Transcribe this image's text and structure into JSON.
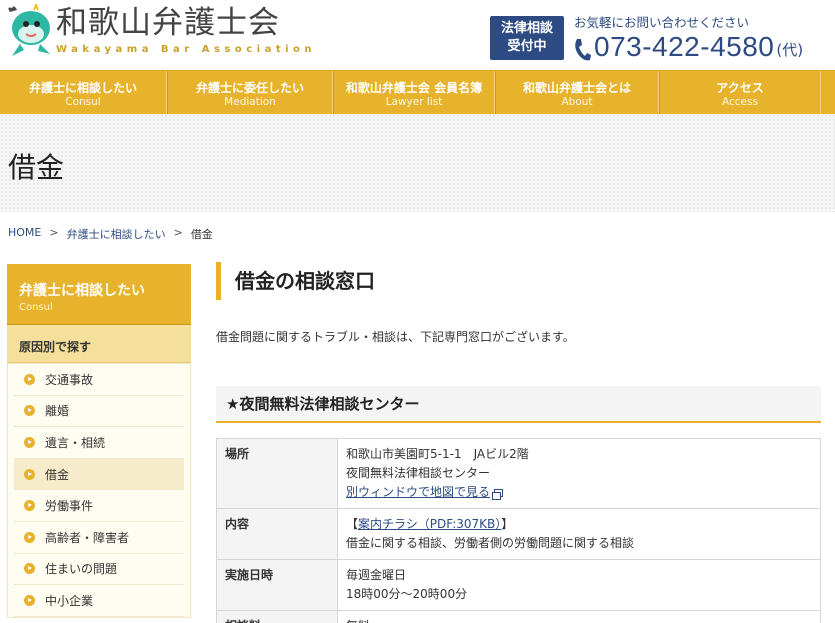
{
  "header": {
    "logo_ja": "和歌山弁護士会",
    "logo_en": "Wakayama Bar Association",
    "badge_line1": "法律相談",
    "badge_line2": "受付中",
    "contact_note": "お気軽にお問い合わせください",
    "phone": "073-422-4580",
    "phone_suffix": "(代)"
  },
  "nav": [
    {
      "ja": "弁護士に相談したい",
      "en": "Consul"
    },
    {
      "ja": "弁護士に委任したい",
      "en": "Mediation"
    },
    {
      "ja": "和歌山弁護士会 会員名簿",
      "en": "Lawyer list"
    },
    {
      "ja": "和歌山弁護士会とは",
      "en": "About"
    },
    {
      "ja": "アクセス",
      "en": "Access"
    }
  ],
  "page_title": "借金",
  "breadcrumb": {
    "home": "HOME",
    "sep": ">",
    "parent": "弁護士に相談したい",
    "current": "借金"
  },
  "sidebar": {
    "head_ja": "弁護士に相談したい",
    "head_en": "Consul",
    "subhead": "原因別で探す",
    "items": [
      "交通事故",
      "離婚",
      "遺言・相続",
      "借金",
      "労働事件",
      "高齢者・障害者",
      "住まいの問題",
      "中小企業"
    ]
  },
  "main": {
    "heading": "借金の相談窓口",
    "intro": "借金問題に関するトラブル・相談は、下記専門窓口がございます。",
    "section_heading": "★夜間無料法律相談センター",
    "table": {
      "place_label": "場所",
      "place_line1": "和歌山市美園町5-1-1　JAビル2階",
      "place_line2": "夜間無料法律相談センター",
      "place_link": "別ウィンドウで地図で見る",
      "content_label": "内容",
      "content_link_open": "【",
      "content_link": "案内チラシ（PDF:307KB）",
      "content_link_close": "】",
      "content_text": "借金に関する相談、労働者側の労働問題に関する相談",
      "date_label": "実施日時",
      "date_line1": "毎週金曜日",
      "date_line2": "18時00分〜20時00分",
      "fee_label": "相談料",
      "fee_value": "無料"
    }
  },
  "colors": {
    "accent": "#e8b32c",
    "navy": "#2d4a82"
  }
}
